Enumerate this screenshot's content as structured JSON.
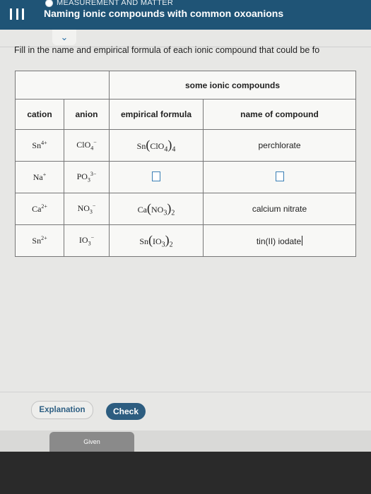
{
  "header": {
    "topic": "MEASUREMENT AND MATTER",
    "title": "Naming ionic compounds with common oxoanions",
    "expand_icon": "chevron-down-icon"
  },
  "instruction": "Fill in the name and empirical formula of each ionic compound that could be fo",
  "table": {
    "caption": "some ionic compounds",
    "headers": {
      "cation": "cation",
      "anion": "anion",
      "formula": "empirical formula",
      "name": "name of compound"
    },
    "rows": [
      {
        "cation": {
          "base": "Sn",
          "charge": "4+"
        },
        "anion": {
          "base": "ClO",
          "sub": "4",
          "charge": "−"
        },
        "formula": {
          "cation": "Sn",
          "anion": "ClO",
          "anion_sub": "4",
          "count": "4"
        },
        "name": "perchlorate"
      },
      {
        "cation": {
          "base": "Na",
          "charge": "+"
        },
        "anion": {
          "base": "PO",
          "sub": "3",
          "charge": "3−"
        },
        "formula": null,
        "name": null
      },
      {
        "cation": {
          "base": "Ca",
          "charge": "2+"
        },
        "anion": {
          "base": "NO",
          "sub": "3",
          "charge": "−"
        },
        "formula": {
          "cation": "Ca",
          "anion": "NO",
          "anion_sub": "3",
          "count": "2"
        },
        "name": "calcium nitrate"
      },
      {
        "cation": {
          "base": "Sn",
          "charge": "2+"
        },
        "anion": {
          "base": "IO",
          "sub": "3",
          "charge": "−"
        },
        "formula": {
          "cation": "Sn",
          "anion": "IO",
          "anion_sub": "3",
          "count": "2"
        },
        "name": "tin(II) iodate"
      }
    ]
  },
  "buttons": {
    "explanation": "Explanation",
    "check": "Check"
  },
  "bottom_tab": "Given"
}
